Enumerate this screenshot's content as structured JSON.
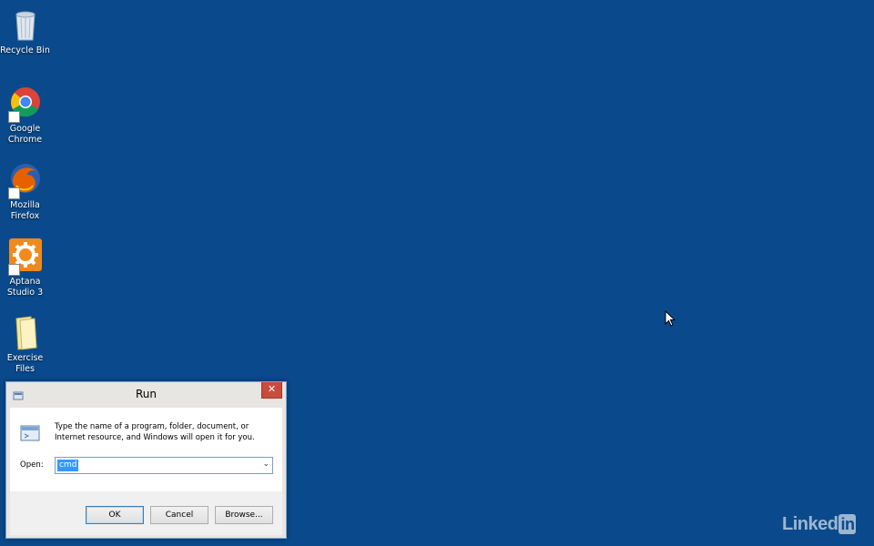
{
  "desktop": {
    "background_color": "#0a4a8c",
    "icons": [
      {
        "label": "Recycle Bin",
        "icon": "recycle-bin-icon"
      },
      {
        "label": "Google\nChrome",
        "icon": "chrome-icon"
      },
      {
        "label": "Mozilla\nFirefox",
        "icon": "firefox-icon"
      },
      {
        "label": "Aptana\nStudio 3",
        "icon": "aptana-icon"
      },
      {
        "label": "Exercise Files",
        "icon": "folder-icon"
      }
    ]
  },
  "run_dialog": {
    "title": "Run",
    "close_glyph": "✕",
    "description": "Type the name of a program, folder, document, or Internet resource, and Windows will open it for you.",
    "open_label": "Open:",
    "open_value": "cmd",
    "buttons": {
      "ok": "OK",
      "cancel": "Cancel",
      "browse": "Browse..."
    }
  },
  "watermark": {
    "text": "Linked",
    "badge": "in"
  }
}
